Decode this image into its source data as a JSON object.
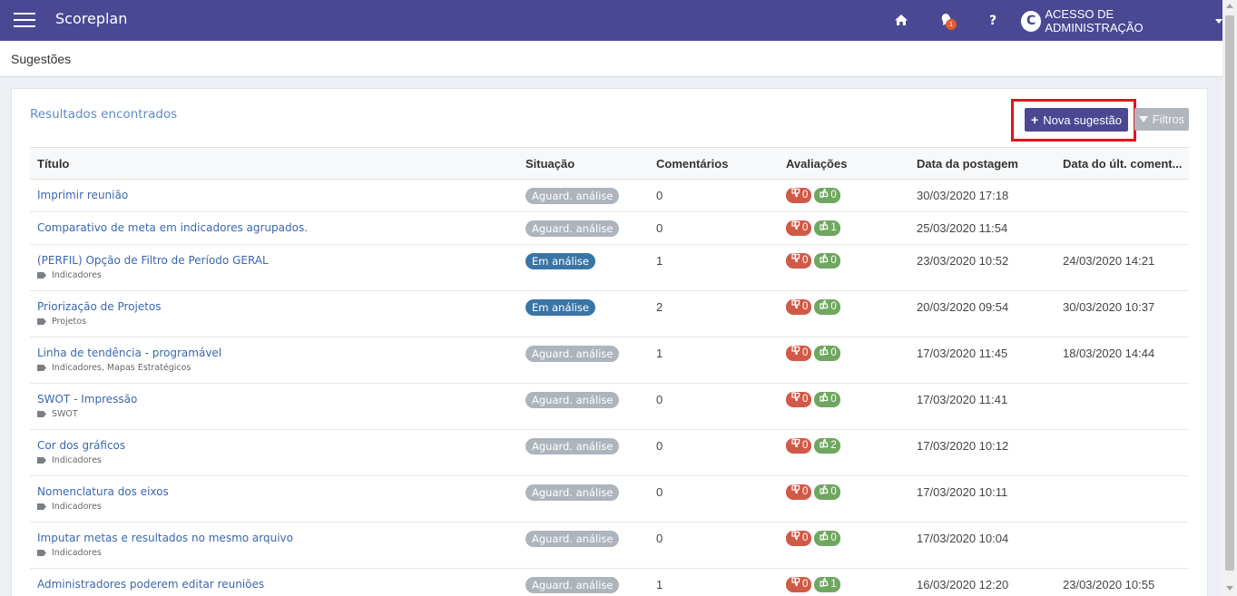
{
  "app": {
    "brand": "Scoreplan",
    "notifications": "1",
    "avatar_letter": "C",
    "user_label": "ACESSO DE ADMINISTRAÇÃO"
  },
  "page": {
    "title": "Sugestões"
  },
  "panel": {
    "title": "Resultados encontrados",
    "new_button": "Nova sugestão",
    "filter_button": "Filtros"
  },
  "table": {
    "headers": [
      "Título",
      "Situação",
      "Comentários",
      "Avaliações",
      "Data da postagem",
      "Data do últ. coment..."
    ],
    "rows": [
      {
        "title": "Imprimir reunião",
        "tags": "",
        "status": "Aguard. análise",
        "status_type": "wait",
        "comments": "0",
        "down": "0",
        "up": "0",
        "posted": "30/03/2020 17:18",
        "last_comment": ""
      },
      {
        "title": "Comparativo de meta em indicadores agrupados.",
        "tags": "",
        "status": "Aguard. análise",
        "status_type": "wait",
        "comments": "0",
        "down": "0",
        "up": "1",
        "posted": "25/03/2020 11:54",
        "last_comment": ""
      },
      {
        "title": "(PERFIL) Opção de Filtro de Período GERAL",
        "tags": "Indicadores",
        "status": "Em análise",
        "status_type": "review",
        "comments": "1",
        "down": "0",
        "up": "0",
        "posted": "23/03/2020 10:52",
        "last_comment": "24/03/2020 14:21"
      },
      {
        "title": "Priorização de Projetos",
        "tags": "Projetos",
        "status": "Em análise",
        "status_type": "review",
        "comments": "2",
        "down": "0",
        "up": "0",
        "posted": "20/03/2020 09:54",
        "last_comment": "30/03/2020 10:37"
      },
      {
        "title": "Linha de tendência - programável",
        "tags": "Indicadores, Mapas Estratégicos",
        "status": "Aguard. análise",
        "status_type": "wait",
        "comments": "1",
        "down": "0",
        "up": "0",
        "posted": "17/03/2020 11:45",
        "last_comment": "18/03/2020 14:44"
      },
      {
        "title": "SWOT - Impressão",
        "tags": "SWOT",
        "status": "Aguard. análise",
        "status_type": "wait",
        "comments": "0",
        "down": "0",
        "up": "0",
        "posted": "17/03/2020 11:41",
        "last_comment": ""
      },
      {
        "title": "Cor dos gráficos",
        "tags": "Indicadores",
        "status": "Aguard. análise",
        "status_type": "wait",
        "comments": "0",
        "down": "0",
        "up": "2",
        "posted": "17/03/2020 10:12",
        "last_comment": ""
      },
      {
        "title": "Nomenclatura dos eixos",
        "tags": "Indicadores",
        "status": "Aguard. análise",
        "status_type": "wait",
        "comments": "0",
        "down": "0",
        "up": "0",
        "posted": "17/03/2020 10:11",
        "last_comment": ""
      },
      {
        "title": "Imputar metas e resultados no mesmo arquivo",
        "tags": "Indicadores",
        "status": "Aguard. análise",
        "status_type": "wait",
        "comments": "0",
        "down": "0",
        "up": "0",
        "posted": "17/03/2020 10:04",
        "last_comment": ""
      },
      {
        "title": "Administradores poderem editar reuniões",
        "tags": "",
        "status": "Aguard. análise",
        "status_type": "wait",
        "comments": "1",
        "down": "0",
        "up": "1",
        "posted": "16/03/2020 12:20",
        "last_comment": "23/03/2020 10:55"
      }
    ]
  },
  "colors": {
    "brand": "#4b4893",
    "link": "#3a67ad",
    "status_wait": "#adb4bc",
    "status_review": "#3a75a6",
    "vote_down": "#d05a48",
    "vote_up": "#6fa660",
    "highlight": "#e3131b"
  },
  "icons": [
    "menu-icon",
    "home-icon",
    "bell-icon",
    "help-icon",
    "caret-down-icon",
    "plus-icon",
    "funnel-icon",
    "tag-icon",
    "thumbs-down-icon",
    "thumbs-up-icon"
  ]
}
